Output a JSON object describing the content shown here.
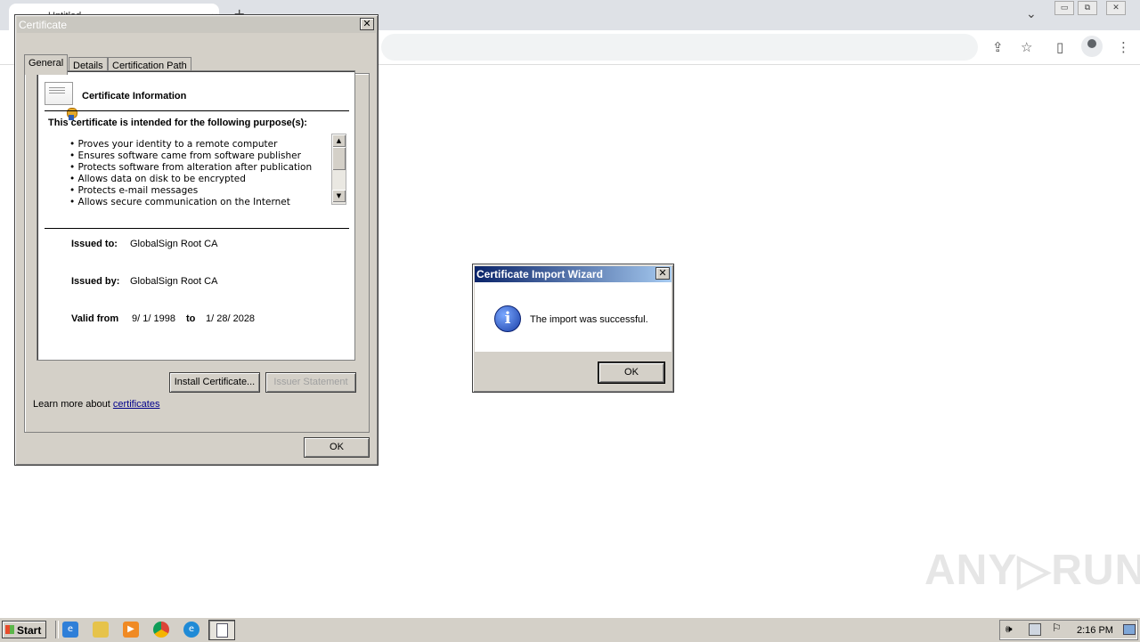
{
  "browser": {
    "tab_title": "Untitled",
    "tab_close": "×",
    "new_tab": "+",
    "chevron": "⌄",
    "win_buttons": [
      "▭",
      "⧉",
      "✕"
    ],
    "toolbar_icons": [
      "⇪",
      "☆",
      "▯",
      "⋮"
    ]
  },
  "cert_dialog": {
    "title": "Certificate",
    "tabs": [
      "General",
      "Details",
      "Certification Path"
    ],
    "heading": "Certificate Information",
    "purpose_heading": "This certificate is intended for the following purpose(s):",
    "purposes": [
      "• Proves your identity to a remote computer",
      "• Ensures software came from software publisher",
      "• Protects software from alteration after publication",
      "• Allows data on disk to be encrypted",
      "• Protects e-mail messages",
      "• Allows secure communication on the Internet"
    ],
    "issued_to_label": "Issued to:",
    "issued_to_value": "GlobalSign Root CA",
    "issued_by_label": "Issued by:",
    "issued_by_value": "GlobalSign Root CA",
    "valid_from_label": "Valid from",
    "valid_from_value": "9/ 1/ 1998",
    "valid_to_label": "to",
    "valid_to_value": "1/ 28/ 2028",
    "install_button": "Install Certificate...",
    "issuer_statement_button": "Issuer Statement",
    "learn_more_prefix": "Learn more about",
    "learn_more_link": "certificates",
    "ok_button": "OK"
  },
  "wizard_dialog": {
    "title": "Certificate Import Wizard",
    "message": "The import was successful.",
    "ok_button": "OK"
  },
  "taskbar": {
    "start_label": "Start",
    "clock": "2:16 PM"
  },
  "watermark": "ANY▷RUN"
}
